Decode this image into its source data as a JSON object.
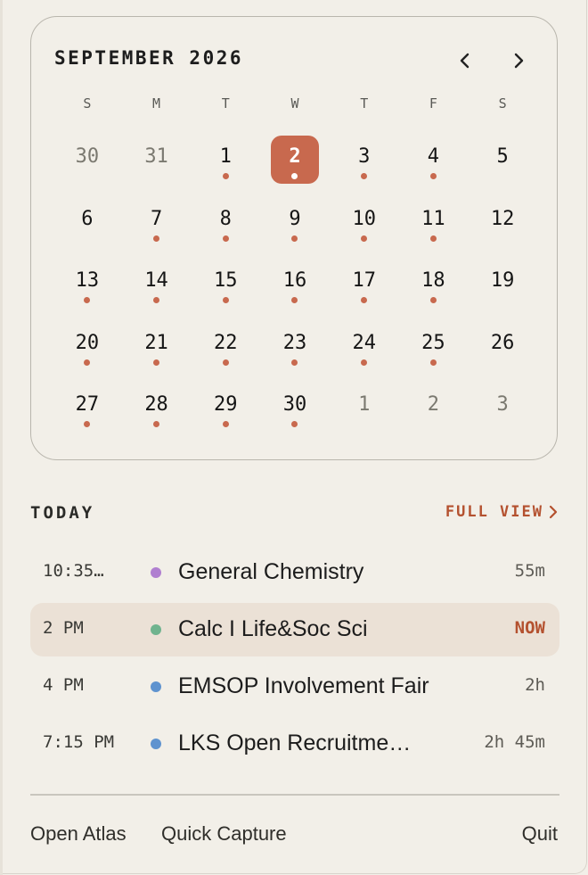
{
  "calendar": {
    "month_title": "SEPTEMBER 2026",
    "prev_icon": "chevron-left-icon",
    "next_icon": "chevron-right-icon",
    "weekdays": [
      "S",
      "M",
      "T",
      "W",
      "T",
      "F",
      "S"
    ],
    "days": [
      {
        "n": "30",
        "muted": true,
        "dot": false
      },
      {
        "n": "31",
        "muted": true,
        "dot": false
      },
      {
        "n": "1",
        "dot": true
      },
      {
        "n": "2",
        "dot": true,
        "selected": true
      },
      {
        "n": "3",
        "dot": true
      },
      {
        "n": "4",
        "dot": true
      },
      {
        "n": "5",
        "dot": false
      },
      {
        "n": "6",
        "dot": false
      },
      {
        "n": "7",
        "dot": true
      },
      {
        "n": "8",
        "dot": true
      },
      {
        "n": "9",
        "dot": true
      },
      {
        "n": "10",
        "dot": true
      },
      {
        "n": "11",
        "dot": true
      },
      {
        "n": "12",
        "dot": false
      },
      {
        "n": "13",
        "dot": true
      },
      {
        "n": "14",
        "dot": true
      },
      {
        "n": "15",
        "dot": true
      },
      {
        "n": "16",
        "dot": true
      },
      {
        "n": "17",
        "dot": true
      },
      {
        "n": "18",
        "dot": true
      },
      {
        "n": "19",
        "dot": false
      },
      {
        "n": "20",
        "dot": true
      },
      {
        "n": "21",
        "dot": true
      },
      {
        "n": "22",
        "dot": true
      },
      {
        "n": "23",
        "dot": true
      },
      {
        "n": "24",
        "dot": true
      },
      {
        "n": "25",
        "dot": true
      },
      {
        "n": "26",
        "dot": false
      },
      {
        "n": "27",
        "dot": true
      },
      {
        "n": "28",
        "dot": true
      },
      {
        "n": "29",
        "dot": true
      },
      {
        "n": "30",
        "dot": true
      },
      {
        "n": "1",
        "muted": true,
        "dot": false
      },
      {
        "n": "2",
        "muted": true,
        "dot": false
      },
      {
        "n": "3",
        "muted": true,
        "dot": false
      }
    ]
  },
  "today": {
    "label": "TODAY",
    "full_view_label": "FULL VIEW",
    "events": [
      {
        "time": "10:35…",
        "title": "General Chemistry",
        "duration": "55m",
        "color": "#b07fd0",
        "now": false
      },
      {
        "time": "2 PM",
        "title": "Calc I Life&Soc Sci",
        "duration": "NOW",
        "color": "#6fb38e",
        "now": true
      },
      {
        "time": "4 PM",
        "title": "EMSOP Involvement Fair",
        "duration": "2h",
        "color": "#5f93cf",
        "now": false
      },
      {
        "time": "7:15 PM",
        "title": "LKS Open Recruitme…",
        "duration": "2h 45m",
        "color": "#5f93cf",
        "now": false
      }
    ]
  },
  "footer": {
    "open_atlas": "Open Atlas",
    "quick_capture": "Quick Capture",
    "quit": "Quit"
  },
  "colors": {
    "accent": "#c8694e",
    "accent_text": "#b4512f",
    "background": "#f2efe8",
    "now_highlight": "#ebe1d6"
  }
}
